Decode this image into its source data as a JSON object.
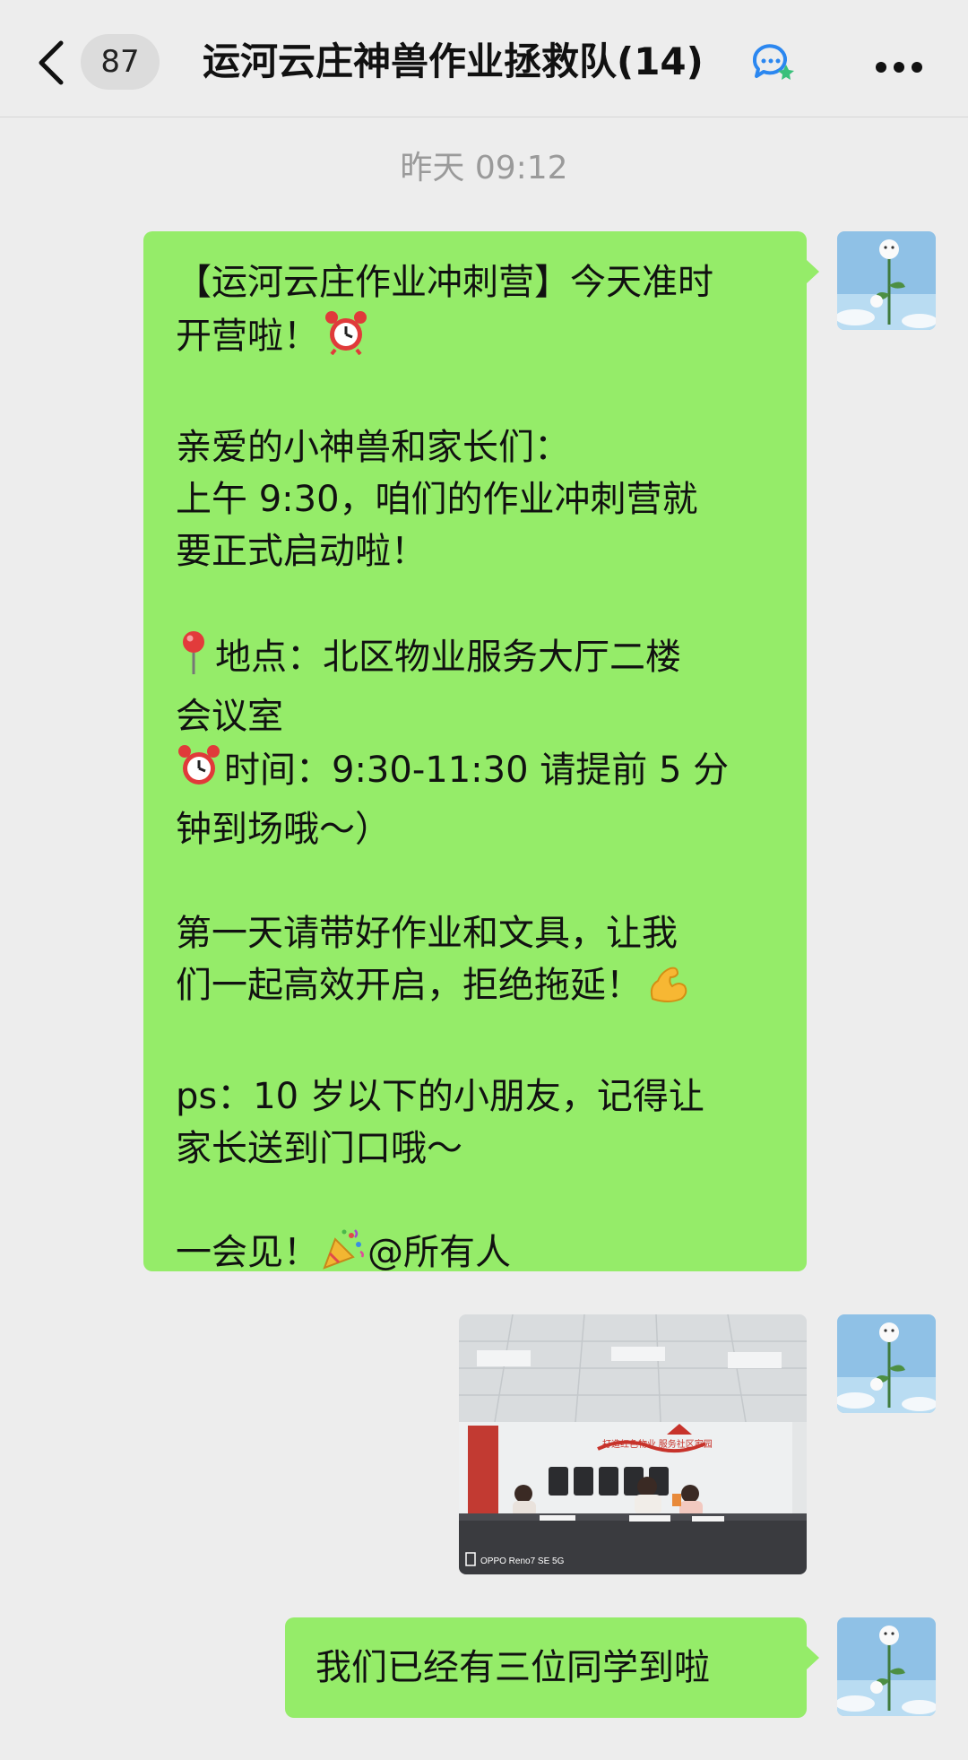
{
  "header": {
    "unread_count": "87",
    "title": "运河云庄神兽作业拯救队(14)"
  },
  "timestamp": "昨天 09:12",
  "messages": {
    "announcement": {
      "line1": "【运河云庄作业冲刺营】今天准时",
      "line2": "开营啦！",
      "line3": "亲爱的小神兽和家长们：",
      "line4": "上午 9:30，咱们的作业冲刺营就",
      "line5": "要正式启动啦！",
      "line6": "地点：北区物业服务大厅二楼",
      "line7": "会议室",
      "line8": "时间：9:30-11:30 请提前 5 分",
      "line9": "钟到场哦～）",
      "line10": "第一天请带好作业和文具，让我",
      "line11": "们一起高效开启，拒绝拖延！",
      "line12": "ps：10 岁以下的小朋友，记得让",
      "line13": "家长送到门口哦～",
      "line14_a": "一会见！",
      "line14_b": "@所有人"
    },
    "photo": {
      "banner_text": "打造红色物业 服务社区家园",
      "watermark": "OPPO Reno7 SE 5G"
    },
    "short": {
      "text": "我们已经有三位同学到啦"
    }
  },
  "icons": {
    "back": "chevron-left-icon",
    "group": "group-chat-icon",
    "more": "more-icon",
    "alarm": "alarm-clock-icon",
    "pin": "location-pin-icon",
    "muscle": "flexed-bicep-icon",
    "party": "party-popper-icon"
  },
  "colors": {
    "bubble": "#95ec69",
    "background": "#ededed"
  }
}
